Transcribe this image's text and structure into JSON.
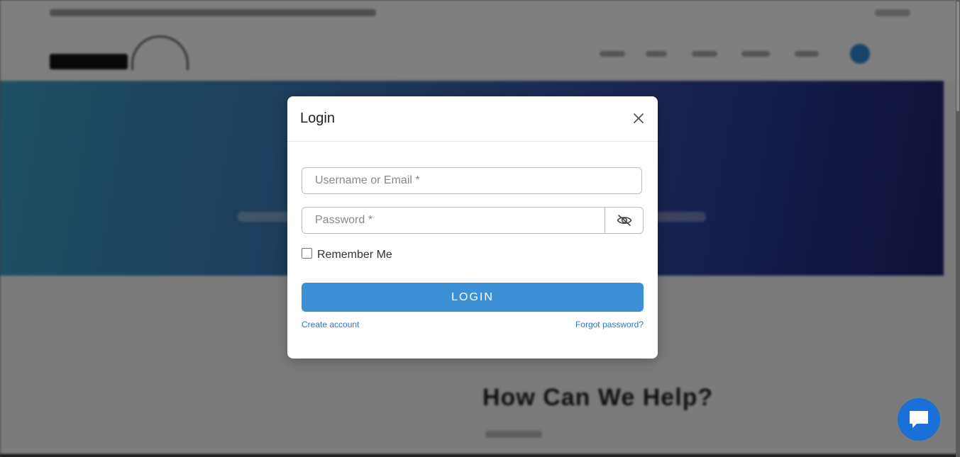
{
  "modal": {
    "title": "Login",
    "username_placeholder": "Username or Email *",
    "username_value": "",
    "password_placeholder": "Password *",
    "password_value": "",
    "remember_label": "Remember Me",
    "remember_checked": false,
    "login_label": "LOGIN",
    "create_account_label": "Create account",
    "forgot_password_label": "Forgot password?"
  },
  "background": {
    "help_title": "How Can We Help?"
  },
  "icons": {
    "close": "close-icon",
    "password_visibility": "eye-off-icon",
    "chat": "chat-bubble-icon"
  },
  "colors": {
    "primary": "#3b90d6",
    "link": "#2a78c4",
    "chat": "#1b6fd8"
  }
}
